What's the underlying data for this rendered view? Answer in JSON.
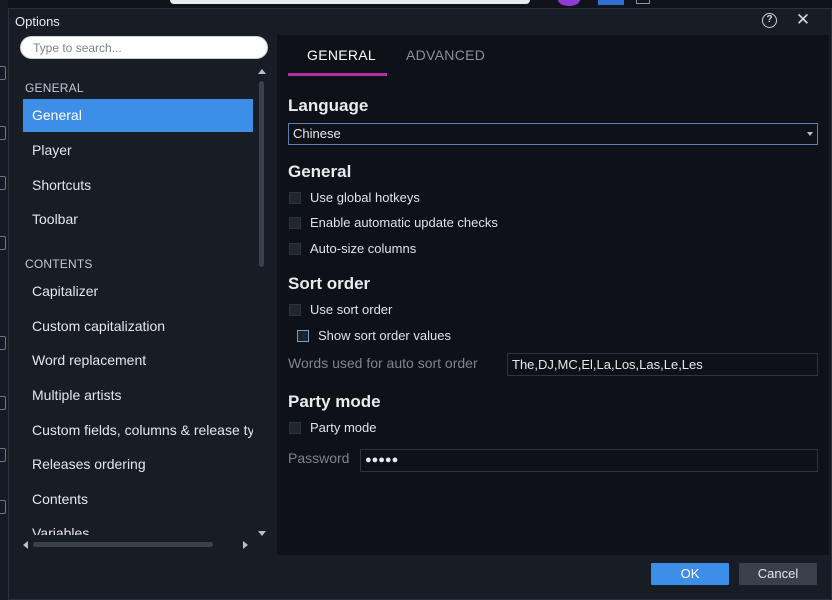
{
  "window": {
    "title": "Options"
  },
  "search": {
    "placeholder": "Type to search..."
  },
  "sidebar": {
    "sections": [
      {
        "label": "GENERAL"
      },
      {
        "label": "CONTENTS"
      }
    ],
    "items": [
      {
        "label": "General",
        "selected": true
      },
      {
        "label": "Player"
      },
      {
        "label": "Shortcuts"
      },
      {
        "label": "Toolbar"
      },
      {
        "label": "Capitalizer"
      },
      {
        "label": "Custom capitalization"
      },
      {
        "label": "Word replacement"
      },
      {
        "label": "Multiple artists"
      },
      {
        "label": "Custom fields, columns & release ty"
      },
      {
        "label": "Releases ordering"
      },
      {
        "label": "Contents"
      },
      {
        "label": "Variables"
      }
    ]
  },
  "tabs": [
    {
      "label": "GENERAL",
      "active": true
    },
    {
      "label": "ADVANCED",
      "active": false
    }
  ],
  "language": {
    "heading": "Language",
    "value": "Chinese"
  },
  "general": {
    "heading": "General",
    "options": [
      {
        "label": "Use global hotkeys",
        "checked": false
      },
      {
        "label": "Enable automatic update checks",
        "checked": false
      },
      {
        "label": "Auto-size columns",
        "checked": false
      }
    ]
  },
  "sort_order": {
    "heading": "Sort order",
    "use_sort_order": {
      "label": "Use sort order",
      "checked": false
    },
    "show_values": {
      "label": "Show sort order values",
      "checked": false
    },
    "words_label": "Words used for auto sort order",
    "words_value": "The,DJ,MC,El,La,Los,Las,Le,Les"
  },
  "party_mode": {
    "heading": "Party mode",
    "option": {
      "label": "Party mode",
      "checked": false
    },
    "password_label": "Password",
    "password_value": "●●●●●"
  },
  "buttons": {
    "ok": "OK",
    "cancel": "Cancel"
  },
  "colors": {
    "accent": "#3d8ee6",
    "tab_underline": "#b42fa4",
    "panel": "#0e1118",
    "dialog": "#181c25"
  }
}
